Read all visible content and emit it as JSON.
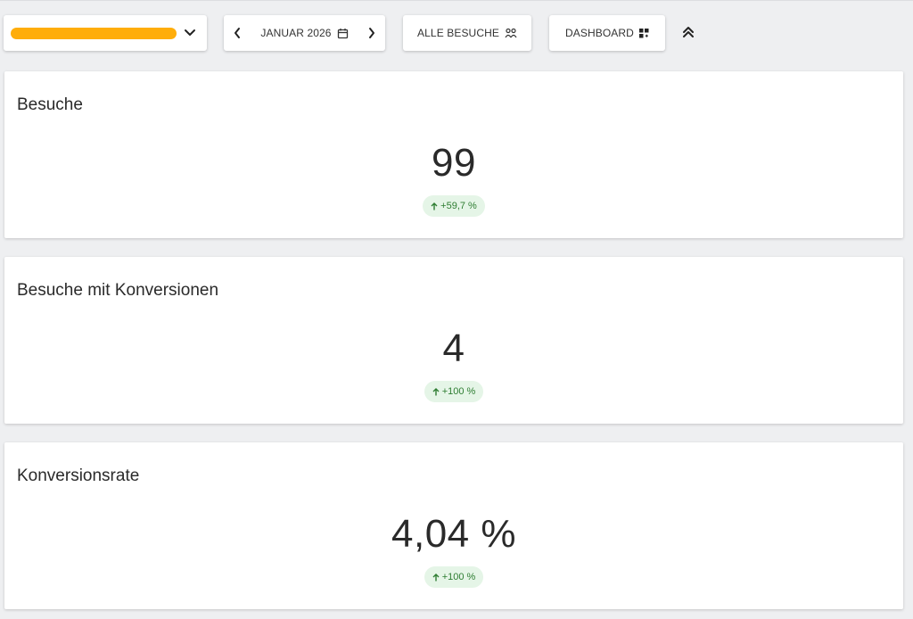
{
  "toolbar": {
    "selector": {
      "value_redacted": true,
      "icon": "chevron-down-icon"
    },
    "month": {
      "label": "JANUAR 2026",
      "prev_icon": "chevron-left-icon",
      "next_icon": "chevron-right-icon",
      "calendar_icon": "calendar-icon"
    },
    "visits_button": {
      "label": "ALLE BESUCHE",
      "icon": "people-group-icon"
    },
    "dashboard_button": {
      "label": "DASHBOARD",
      "icon": "dashboard-grid-icon"
    },
    "collapse_icon": "double-chevron-up-icon"
  },
  "cards": [
    {
      "title": "Besuche",
      "value": "99",
      "change": "+59,7 %",
      "trend": "up"
    },
    {
      "title": "Besuche mit Konversionen",
      "value": "4",
      "change": "+100 %",
      "trend": "up"
    },
    {
      "title": "Konversionsrate",
      "value": "4,04 %",
      "change": "+100 %",
      "trend": "up"
    }
  ],
  "colors": {
    "background": "#eeeff1",
    "card": "#ffffff",
    "masked_selector": "#ffad0a",
    "badge_bg": "#e5f5e7",
    "badge_text": "#2e7d32"
  }
}
